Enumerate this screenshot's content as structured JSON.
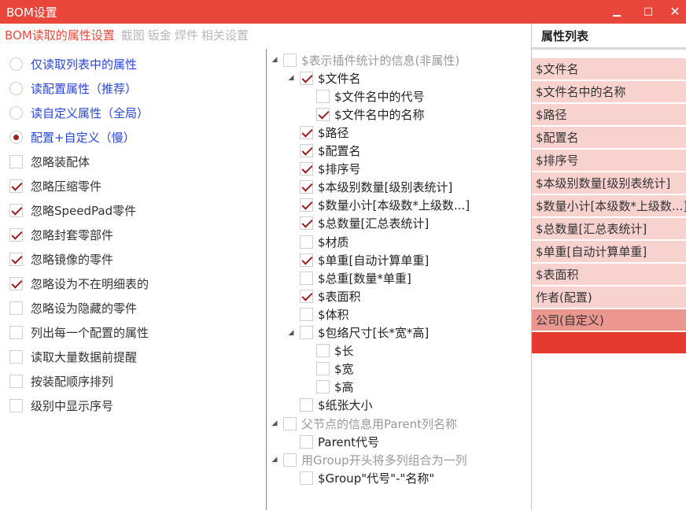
{
  "window": {
    "title": "BOM设置",
    "min_label": "▁",
    "max_label": "□",
    "close_label": "✕"
  },
  "tabs": [
    {
      "label": "BOM读取的属性设置",
      "active": true
    },
    {
      "label": "截图",
      "active": false
    },
    {
      "label": "钣金",
      "active": false
    },
    {
      "label": "焊件",
      "active": false
    },
    {
      "label": "相关设置",
      "active": false
    }
  ],
  "left": {
    "radios": [
      {
        "label": "仅读取列表中的属性",
        "checked": false
      },
      {
        "label": "读配置属性（推荐）",
        "checked": false
      },
      {
        "label": "读自定义属性（全局）",
        "checked": false
      },
      {
        "label": "配置+自定义（慢）",
        "checked": true
      }
    ],
    "checkboxes": [
      {
        "label": "忽略装配体",
        "checked": false
      },
      {
        "label": "忽略压缩零件",
        "checked": true
      },
      {
        "label": "忽略SpeedPad零件",
        "checked": true
      },
      {
        "label": "忽略封套零部件",
        "checked": true
      },
      {
        "label": "忽略镜像的零件",
        "checked": true
      },
      {
        "label": "忽略设为不在明细表的",
        "checked": true
      },
      {
        "label": "忽略设为隐藏的零件",
        "checked": false
      },
      {
        "label": "列出每一个配置的属性",
        "checked": false
      },
      {
        "label": "读取大量数据前提醒",
        "checked": false
      },
      {
        "label": "按装配顺序排列",
        "checked": false
      },
      {
        "label": "级别中显示序号",
        "checked": false
      }
    ]
  },
  "tree": [
    {
      "label": "$表示插件统计的信息(非属性)",
      "level": 0,
      "expander": "◢",
      "checked": false,
      "gray": true
    },
    {
      "label": "$文件名",
      "level": 1,
      "expander": "◢",
      "checked": true,
      "gray": false
    },
    {
      "label": "$文件名中的代号",
      "level": 2,
      "expander": "",
      "checked": false,
      "gray": false
    },
    {
      "label": "$文件名中的名称",
      "level": 2,
      "expander": "",
      "checked": true,
      "gray": false
    },
    {
      "label": "$路径",
      "level": 1,
      "expander": "",
      "checked": true,
      "gray": false
    },
    {
      "label": "$配置名",
      "level": 1,
      "expander": "",
      "checked": true,
      "gray": false
    },
    {
      "label": "$排序号",
      "level": 1,
      "expander": "",
      "checked": true,
      "gray": false
    },
    {
      "label": "$本级别数量[级别表统计]",
      "level": 1,
      "expander": "",
      "checked": true,
      "gray": false
    },
    {
      "label": "$数量小计[本级数*上级数...]",
      "level": 1,
      "expander": "",
      "checked": true,
      "gray": false
    },
    {
      "label": "$总数量[汇总表统计]",
      "level": 1,
      "expander": "",
      "checked": true,
      "gray": false
    },
    {
      "label": "$材质",
      "level": 1,
      "expander": "",
      "checked": false,
      "gray": false
    },
    {
      "label": "$单重[自动计算单重]",
      "level": 1,
      "expander": "",
      "checked": true,
      "gray": false
    },
    {
      "label": "$总重[数量*单重]",
      "level": 1,
      "expander": "",
      "checked": false,
      "gray": false
    },
    {
      "label": "$表面积",
      "level": 1,
      "expander": "",
      "checked": true,
      "gray": false
    },
    {
      "label": "$体积",
      "level": 1,
      "expander": "",
      "checked": false,
      "gray": false
    },
    {
      "label": "$包络尺寸[长*宽*高]",
      "level": 1,
      "expander": "◢",
      "checked": false,
      "gray": false
    },
    {
      "label": "$长",
      "level": 2,
      "expander": "",
      "checked": false,
      "gray": false
    },
    {
      "label": "$宽",
      "level": 2,
      "expander": "",
      "checked": false,
      "gray": false
    },
    {
      "label": "$高",
      "level": 2,
      "expander": "",
      "checked": false,
      "gray": false
    },
    {
      "label": "$纸张大小",
      "level": 1,
      "expander": "",
      "checked": false,
      "gray": false
    },
    {
      "label": "父节点的信息用Parent列名称",
      "level": 0,
      "expander": "◢",
      "checked": false,
      "gray": true
    },
    {
      "label": "Parent代号",
      "level": 1,
      "expander": "",
      "checked": false,
      "gray": false
    },
    {
      "label": "用Group开头将多列组合为一列",
      "level": 0,
      "expander": "◢",
      "checked": false,
      "gray": true
    },
    {
      "label": "$Group\"代号\"-\"名称\"",
      "level": 1,
      "expander": "",
      "checked": false,
      "gray": false
    }
  ],
  "right": {
    "header": "属性列表",
    "items": [
      {
        "label": "$文件名",
        "style": "normal"
      },
      {
        "label": "$文件名中的名称",
        "style": "normal"
      },
      {
        "label": "$路径",
        "style": "normal"
      },
      {
        "label": "$配置名",
        "style": "normal"
      },
      {
        "label": "$排序号",
        "style": "normal"
      },
      {
        "label": "$本级别数量[级别表统计]",
        "style": "normal"
      },
      {
        "label": "$数量小计[本级数*上级数...]",
        "style": "normal"
      },
      {
        "label": "$总数量[汇总表统计]",
        "style": "normal"
      },
      {
        "label": "$单重[自动计算单重]",
        "style": "normal"
      },
      {
        "label": "$表面积",
        "style": "normal"
      },
      {
        "label": "作者(配置)",
        "style": "normal"
      },
      {
        "label": "公司(自定义)",
        "style": "dark"
      },
      {
        "label": "",
        "style": "selected"
      }
    ]
  }
}
